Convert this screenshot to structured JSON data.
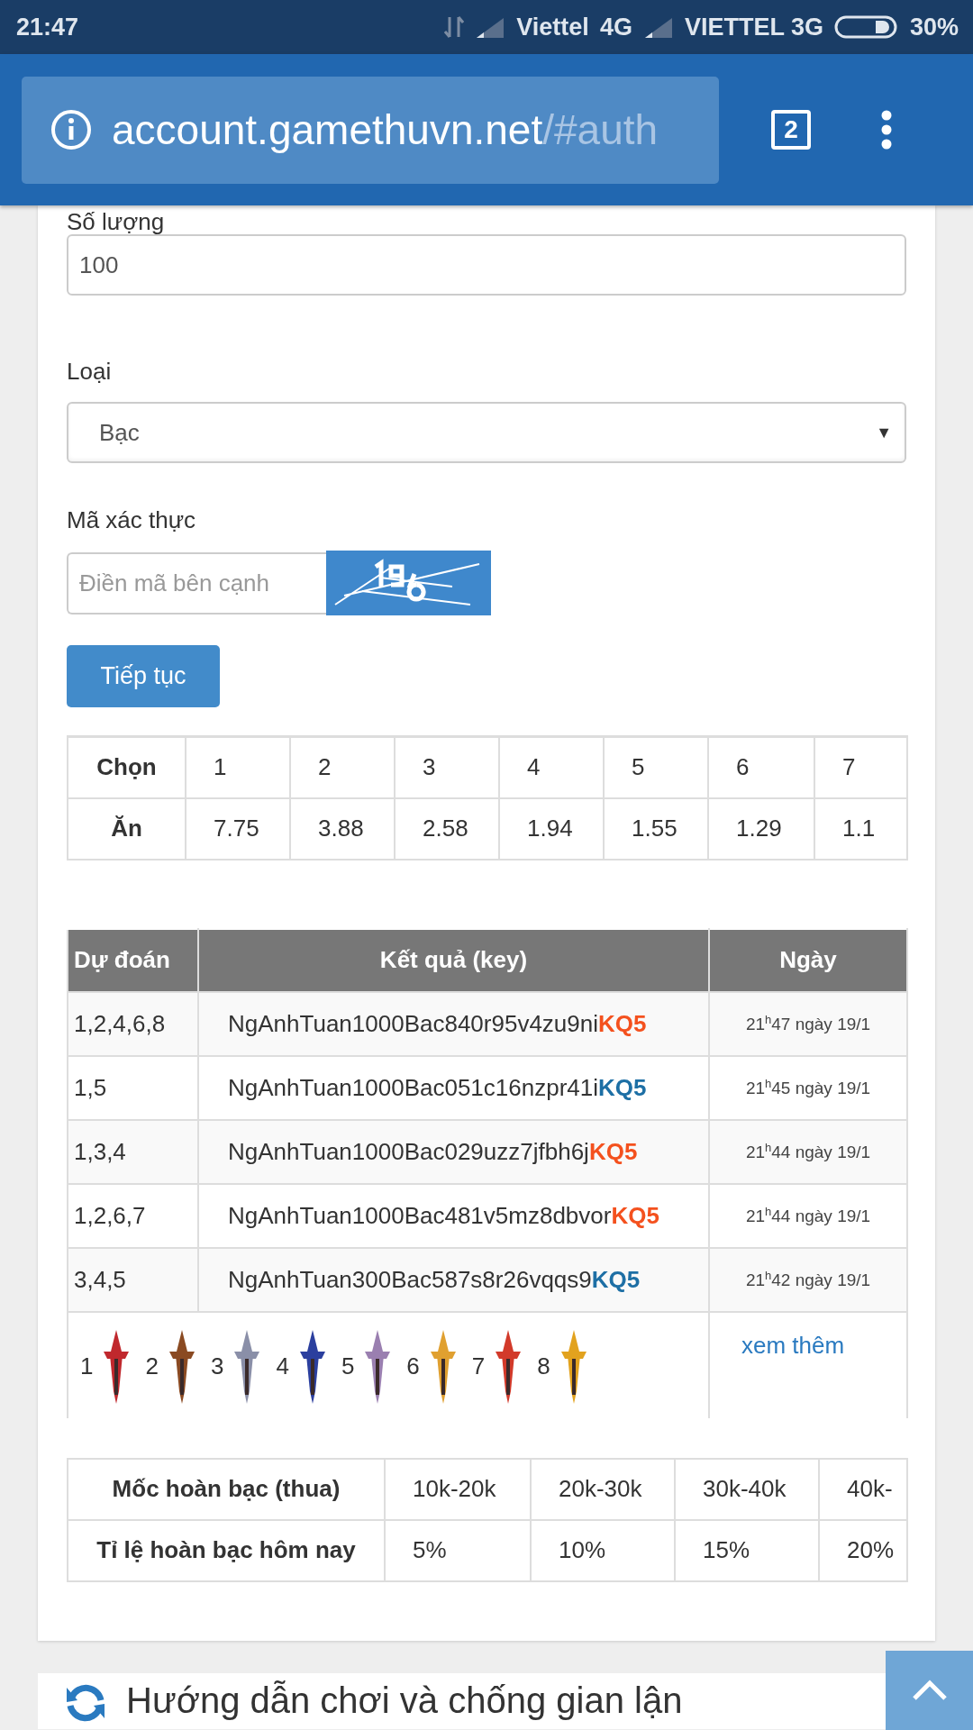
{
  "status_bar": {
    "time": "21:47",
    "carrier_1": "Viettel",
    "network_1": "4G",
    "carrier_2": "VIETTEL 3G",
    "battery": "30%"
  },
  "browser": {
    "url_host": "account.gamethuvn.net",
    "url_path": "/#auth",
    "tab_count": "2"
  },
  "form": {
    "quantity": {
      "label": "Số lượng",
      "value": "100"
    },
    "type": {
      "label": "Loại",
      "value": "Bạc",
      "caret": "▼"
    },
    "captcha": {
      "label": "Mã xác thực",
      "placeholder": "Điền mã bên cạnh"
    },
    "submit": "Tiếp tục"
  },
  "odds_table": {
    "rows": [
      {
        "header": "Chọn",
        "cells": [
          "1",
          "2",
          "3",
          "4",
          "5",
          "6",
          "7"
        ]
      },
      {
        "header": "Ăn",
        "cells": [
          "7.75",
          "3.88",
          "2.58",
          "1.94",
          "1.55",
          "1.29",
          "1.1"
        ]
      }
    ]
  },
  "history_table": {
    "columns": [
      "Dự đoán",
      "Kết quả (key)",
      "Ngày"
    ],
    "rows": [
      {
        "prediction": "1,2,4,6,8",
        "key": "NgAnhTuan1000Bac840r95v4zu9ni",
        "result": "KQ5",
        "color": "#f4511e",
        "time": "21$^{h}$47 ngày 19/1"
      },
      {
        "prediction": "1,5",
        "key": "NgAnhTuan1000Bac051c16nzpr41i",
        "result": "KQ5",
        "color": "#1d6fa5",
        "time": "21$^{h}$45 ngày 19/1"
      },
      {
        "prediction": "1,3,4",
        "key": "NgAnhTuan1000Bac029uzz7jfbh6j",
        "result": "KQ5",
        "color": "#f4511e",
        "time": "21$^{h}$44 ngày 19/1"
      },
      {
        "prediction": "1,2,6,7",
        "key": "NgAnhTuan1000Bac481v5mz8dbvor",
        "result": "KQ5",
        "color": "#f4511e",
        "time": "21$^{h}$44 ngày 19/1"
      },
      {
        "prediction": "3,4,5",
        "key": "NgAnhTuan300Bac587s8r26vqqs9",
        "result": "KQ5",
        "color": "#1d6fa5",
        "time": "21$^{h}$42 ngày 19/1"
      }
    ],
    "legend": [
      {
        "label": "1",
        "color": "#c0282d"
      },
      {
        "label": "2",
        "color": "#8a4a22"
      },
      {
        "label": "3",
        "color": "#8a8fa8"
      },
      {
        "label": "4",
        "color": "#2b3f9e"
      },
      {
        "label": "5",
        "color": "#9a7fb0"
      },
      {
        "label": "6",
        "color": "#e0a030"
      },
      {
        "label": "7",
        "color": "#d23a2a"
      },
      {
        "label": "8",
        "color": "#e2a21e"
      }
    ],
    "more_link": "xem thêm"
  },
  "refund_table": {
    "rows": [
      {
        "header": "Mốc hoàn bạc (thua)",
        "cells": [
          "10k-20k",
          "20k-30k",
          "30k-40k",
          "40k-"
        ]
      },
      {
        "header": "Tỉ lệ hoàn bạc hôm nay",
        "cells": [
          "5%",
          "10%",
          "15%",
          "20%"
        ]
      }
    ]
  },
  "guide_heading": "Hướng dẫn chơi và chống gian lận"
}
